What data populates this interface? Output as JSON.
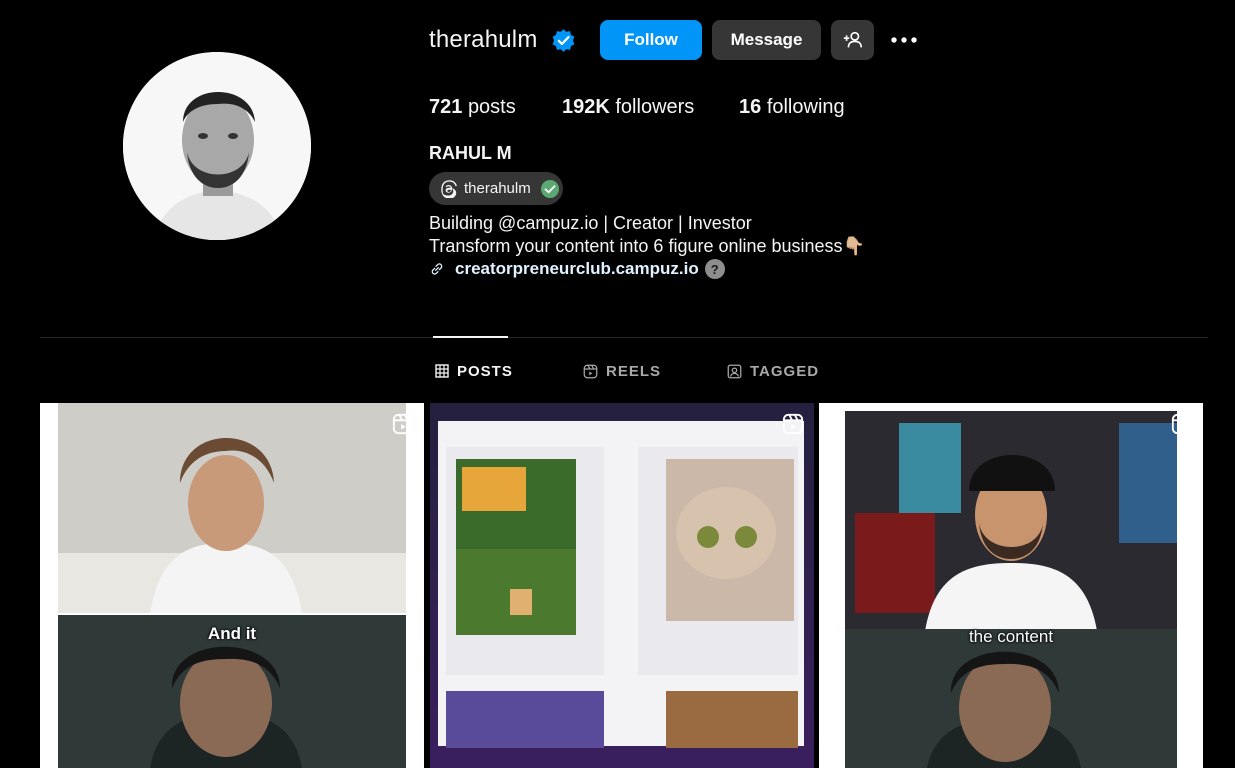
{
  "profile": {
    "username": "therahulm",
    "follow_label": "Follow",
    "message_label": "Message",
    "stats": [
      {
        "count": "721",
        "label": "posts"
      },
      {
        "count": "192K",
        "label": "followers"
      },
      {
        "count": "16",
        "label": "following"
      }
    ],
    "full_name": "RAHUL M",
    "threads_handle": "therahulm",
    "bio_line1": "Building @campuz.io | Creator | Investor",
    "bio_line2": "Transform your content into 6 figure online business",
    "bio_emoji": "👇🏼",
    "link": "creatorpreneurclub.campuz.io",
    "link_help": "?"
  },
  "tabs": [
    {
      "label": "POSTS",
      "icon": "grid-icon",
      "active": true
    },
    {
      "label": "REELS",
      "icon": "reels-icon",
      "active": false
    },
    {
      "label": "TAGGED",
      "icon": "tagged-icon",
      "active": false
    }
  ],
  "posts": [
    {
      "caption": "And it",
      "type": "reel"
    },
    {
      "caption": "",
      "type": "reel"
    },
    {
      "caption": "the content",
      "type": "reel"
    }
  ],
  "colors": {
    "background": "#000000",
    "primary_button": "#0095f6",
    "secondary_button": "#363636",
    "verified": "#0095f6"
  }
}
